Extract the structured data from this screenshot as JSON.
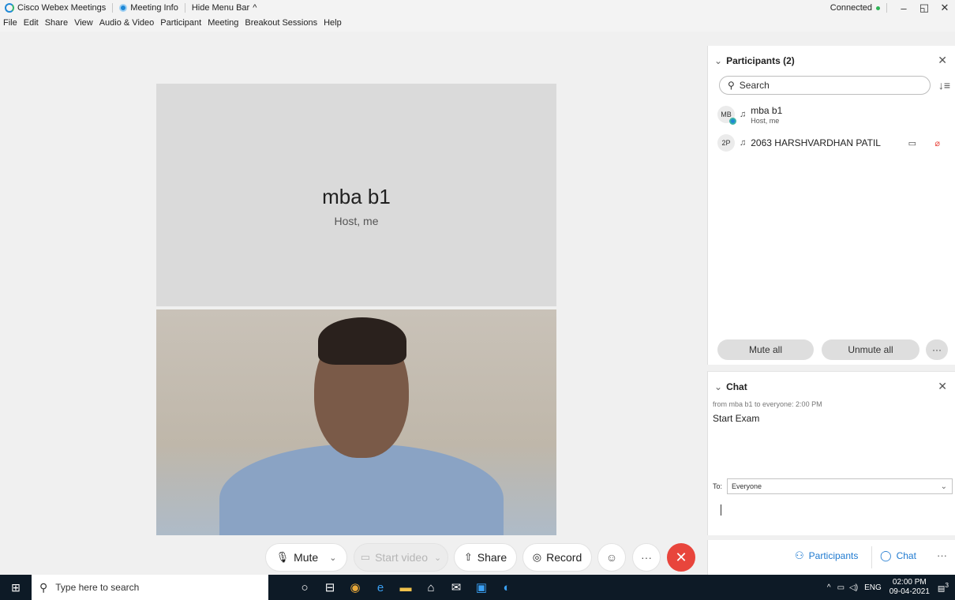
{
  "titlebar": {
    "app_name": "Cisco Webex Meetings",
    "meeting_info": "Meeting Info",
    "hide_menu": "Hide Menu Bar",
    "hide_menu_icon": "^",
    "status": "Connected",
    "minimize": "–",
    "restore": "◱",
    "close": "✕"
  },
  "menu": [
    "File",
    "Edit",
    "Share",
    "View",
    "Audio & Video",
    "Participant",
    "Meeting",
    "Breakout Sessions",
    "Help"
  ],
  "stage": {
    "host_name": "mba b1",
    "host_role": "Host, me"
  },
  "controls": {
    "mute": "Mute",
    "mute_caret": "⌄",
    "start_video": "Start video",
    "video_caret": "⌄",
    "share": "Share",
    "record": "Record",
    "reactions": "☺",
    "more": "···",
    "end": "✕"
  },
  "participants": {
    "title": "Participants (2)",
    "chevron": "⌄",
    "close": "✕",
    "search_placeholder": "Search",
    "sort": "↓≡",
    "list": [
      {
        "initials": "MB",
        "name": "mba b1",
        "role": "Host, me"
      },
      {
        "initials": "2P",
        "name": "2063 HARSHVARDHAN PATIL",
        "role": ""
      }
    ],
    "mute_all": "Mute all",
    "unmute_all": "Unmute all",
    "more": "···"
  },
  "chat": {
    "title": "Chat",
    "chevron": "⌄",
    "close": "✕",
    "meta": "from mba b1 to everyone:   2:00 PM",
    "message": "Start Exam",
    "to_label": "To:",
    "to_value": "Everyone"
  },
  "right_tabs": {
    "participants": "Participants",
    "chat": "Chat",
    "more": "···"
  },
  "taskbar": {
    "search_placeholder": "Type here to search",
    "lang": "ENG",
    "time": "02:00 PM",
    "date": "09-04-2021",
    "notifications": "3"
  },
  "colors": {
    "accent": "#1f7ad0",
    "end_call": "#e8453c",
    "connected": "#2fb357",
    "taskbar": "#0d1a26"
  }
}
